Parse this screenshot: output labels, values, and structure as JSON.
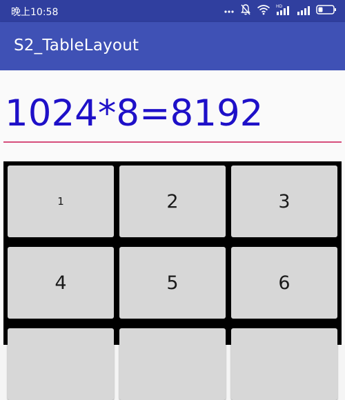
{
  "status_bar": {
    "time": "晚上10:58",
    "icons": [
      "more-dots-icon",
      "mute-bell-icon",
      "wifi-icon",
      "hd-signal-icon",
      "signal-icon",
      "battery-icon"
    ],
    "hd_label": "HD",
    "color": "#303f9f"
  },
  "app_bar": {
    "title": "S2_TableLayout",
    "color": "#3f51b5"
  },
  "display": {
    "text": "1024*8=8192",
    "text_color": "#1e10c8",
    "underline_color": "#d64d7a"
  },
  "keypad": {
    "keys": [
      {
        "label": "1"
      },
      {
        "label": "2"
      },
      {
        "label": "3"
      },
      {
        "label": "4"
      },
      {
        "label": "5"
      },
      {
        "label": "6"
      },
      {
        "label": ""
      },
      {
        "label": ""
      },
      {
        "label": ""
      }
    ],
    "key_color": "#d7d7d7",
    "background_color": "#000000"
  }
}
